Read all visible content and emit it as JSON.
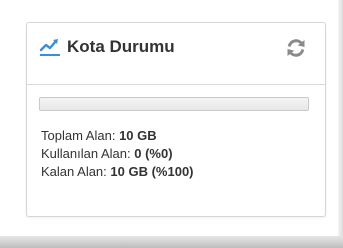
{
  "widget": {
    "title": "Kota Durumu",
    "icon": "line-chart-icon",
    "refresh_icon": "refresh-icon",
    "accent_color": "#3b8fd6",
    "progress": {
      "used_fraction": 0
    },
    "stats": {
      "total_label": "Toplam Alan:",
      "total_value": "10 GB",
      "used_label": "Kullanılan Alan:",
      "used_value": "0 (%0)",
      "free_label": "Kalan Alan:",
      "free_value": "10 GB (%100)"
    }
  }
}
